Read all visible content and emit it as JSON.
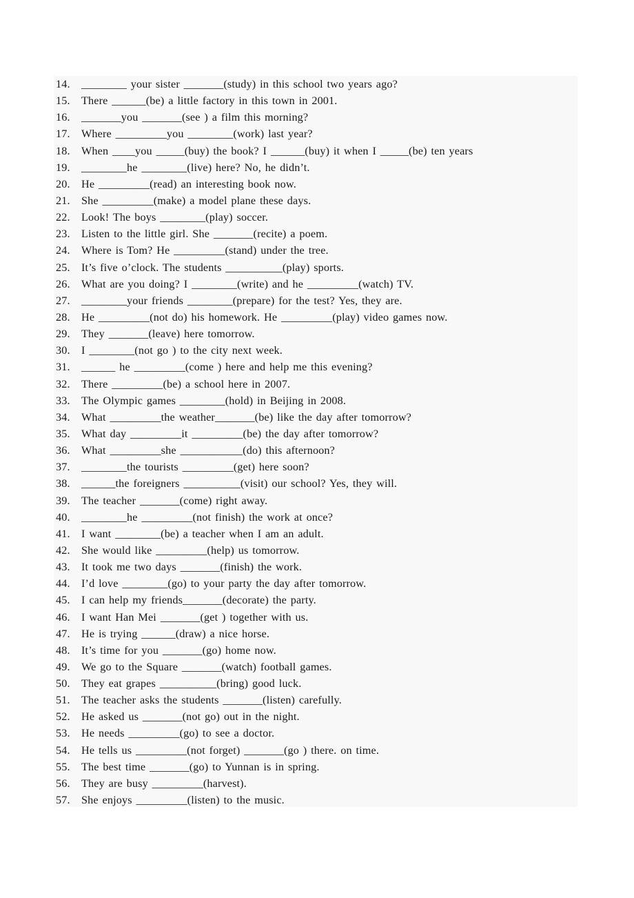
{
  "document": {
    "kind": "grammar-worksheet",
    "background_color": "#ffffff",
    "sheet_color": "#f8f8f8",
    "text_color": "#1a1a1a",
    "exercises": [
      {
        "number": "14.",
        "text": "________  your  sister  _______(study)  in  this  school  two  years  ago?"
      },
      {
        "number": "15.",
        "text": "There  ______(be)  a  little  factory  in  this  town  in  2001."
      },
      {
        "number": "16.",
        "text": "_______you  _______(see )  a  film  this  morning?"
      },
      {
        "number": "17.",
        "text": "Where  _________you  ________(work)  last  year?"
      },
      {
        "number": "18.",
        "text": "When  ____you  _____(buy)  the  book?  I  ______(buy)  it  when  I  _____(be)  ten  years"
      },
      {
        "number": "19.",
        "text": "________he  ________(live)  here?  No,  he  didn’t."
      },
      {
        "number": "20.",
        "text": "He  _________(read)  an  interesting  book  now."
      },
      {
        "number": "21.",
        "text": "She  _________(make)  a  model  plane  these  days."
      },
      {
        "number": "22.",
        "text": "Look!  The  boys  ________(play)  soccer."
      },
      {
        "number": "23.",
        "text": "Listen  to  the  little  girl.  She  _______(recite)  a  poem."
      },
      {
        "number": "24.",
        "text": "Where  is  Tom?  He  _________(stand)  under  the  tree."
      },
      {
        "number": "25.",
        "text": "It’s  five  o’clock.  The  students  __________(play)  sports."
      },
      {
        "number": "26.",
        "text": "What  are  you  doing?  I  ________(write)  and  he  _________(watch)  TV."
      },
      {
        "number": "27.",
        "text": "________your  friends  ________(prepare)  for  the  test?  Yes,  they  are."
      },
      {
        "number": "28.",
        "text": "He  _________(not do)  his  homework.  He  _________(play)  video  games  now."
      },
      {
        "number": "29.",
        "text": "They  _______(leave)  here  tomorrow."
      },
      {
        "number": "30.",
        "text": "I  ________(not go )  to  the  city  next  week."
      },
      {
        "number": "31.",
        "text": "______  he  _________(come )  here  and  help  me  this  evening?"
      },
      {
        "number": "32.",
        "text": "There  _________(be)  a  school  here  in  2007."
      },
      {
        "number": "33.",
        "text": "The  Olympic  games  ________(hold)  in  Beijing  in  2008."
      },
      {
        "number": "34.",
        "text": "What  _________the  weather_______(be)  like  the  day  after  tomorrow?"
      },
      {
        "number": "35.",
        "text": "What  day  _________it  _________(be)  the  day  after  tomorrow?"
      },
      {
        "number": "36.",
        "text": "What  _________she  ___________(do)  this  afternoon?"
      },
      {
        "number": "37.",
        "text": "________the  tourists  _________(get)  here  soon?"
      },
      {
        "number": "38.",
        "text": "______the  foreigners  __________(visit)  our  school?  Yes,  they  will."
      },
      {
        "number": "39.",
        "text": "The  teacher  _______(come)  right  away."
      },
      {
        "number": "40.",
        "text": " ________he  _________(not finish)  the  work  at  once?"
      },
      {
        "number": "41.",
        "text": "I  want  ________(be)  a  teacher  when  I  am  an  adult."
      },
      {
        "number": "42.",
        "text": "She  would  like  _________(help)  us  tomorrow."
      },
      {
        "number": "43.",
        "text": "It  took  me  two  days  _______(finish)  the  work."
      },
      {
        "number": "44.",
        "text": "I’d  love  ________(go)  to  your  party  the  day  after  tomorrow."
      },
      {
        "number": "45.",
        "text": "I  can  help  my  friends_______(decorate)  the  party."
      },
      {
        "number": "46.",
        "text": "I  want  Han  Mei  _______(get )  together  with  us."
      },
      {
        "number": "47.",
        "text": "He  is  trying  ______(draw)  a  nice  horse."
      },
      {
        "number": "48.",
        "text": "It’s  time  for  you  _______(go)  home  now."
      },
      {
        "number": "49.",
        "text": "We  go  to  the  Square  _______(watch)  football  games."
      },
      {
        "number": "50.",
        "text": "They  eat  grapes  __________(bring)  good  luck."
      },
      {
        "number": "51.",
        "text": "The  teacher  asks  the  students  _______(listen)  carefully."
      },
      {
        "number": "52.",
        "text": "He  asked  us  _______(not go)  out  in  the  night."
      },
      {
        "number": "53.",
        "text": "He  needs  _________(go)  to  see  a  doctor."
      },
      {
        "number": "54.",
        "text": "He  tells  us  _________(not forget)  _______(go )  there.  on  time."
      },
      {
        "number": "55.",
        "text": "The  best  time  _______(go)  to  Yunnan  is  in  spring."
      },
      {
        "number": "56.",
        "text": "They  are  busy  _________(harvest)."
      },
      {
        "number": "57.",
        "text": "She  enjoys  _________(listen)  to  the  music."
      }
    ]
  }
}
